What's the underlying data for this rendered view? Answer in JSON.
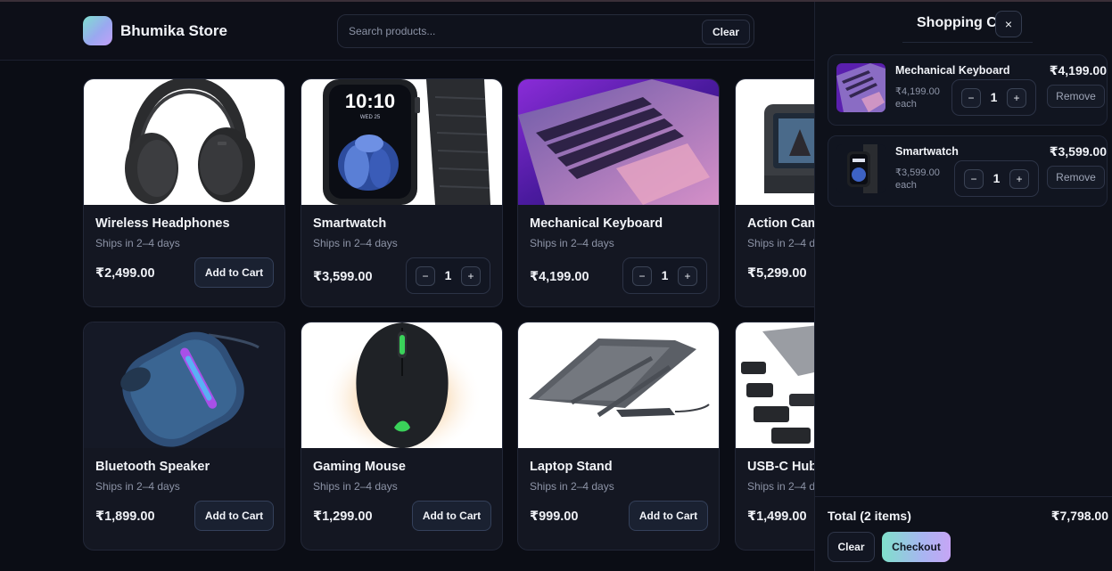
{
  "header": {
    "brand": "Bhumika Store",
    "search_placeholder": "Search products...",
    "search_value": "",
    "clear_label": "Clear"
  },
  "products": [
    {
      "name": "Wireless Headphones",
      "ship": "Ships in 2–4 days",
      "price": "₹2,499.00",
      "action": "Add to Cart"
    },
    {
      "name": "Smartwatch",
      "ship": "Ships in 2–4 days",
      "price": "₹3,599.00",
      "qty": "1",
      "minus": "−",
      "plus": "+"
    },
    {
      "name": "Mechanical Keyboard",
      "ship": "Ships in 2–4 days",
      "price": "₹4,199.00",
      "qty": "1",
      "minus": "−",
      "plus": "+"
    },
    {
      "name": "Action Cam",
      "ship": "Ships in 2–4 d",
      "price": "₹5,299.00"
    },
    {
      "name": "Bluetooth Speaker",
      "ship": "Ships in 2–4 days",
      "price": "₹1,899.00",
      "action": "Add to Cart"
    },
    {
      "name": "Gaming Mouse",
      "ship": "Ships in 2–4 days",
      "price": "₹1,299.00",
      "action": "Add to Cart"
    },
    {
      "name": "Laptop Stand",
      "ship": "Ships in 2–4 days",
      "price": "₹999.00",
      "action": "Add to Cart"
    },
    {
      "name": "USB-C Hub",
      "ship": "Ships in 2–4 d",
      "price": "₹1,499.00"
    }
  ],
  "watch_face": {
    "time": "10:10",
    "date": "WED 25"
  },
  "cart": {
    "title": "Shopping C",
    "close_glyph": "×",
    "items": [
      {
        "name": "Mechanical Keyboard",
        "unit_price": "₹4,199.00",
        "each": "each",
        "qty": "1",
        "total": "₹4,199.00",
        "remove": "Remove",
        "minus": "−",
        "plus": "+"
      },
      {
        "name": "Smartwatch",
        "unit_price": "₹3,599.00",
        "each": "each",
        "qty": "1",
        "total": "₹3,599.00",
        "remove": "Remove",
        "minus": "−",
        "plus": "+"
      }
    ],
    "total_label": "Total (2 items)",
    "total_value": "₹7,798.00",
    "clear_label": "Clear",
    "checkout_label": "Checkout"
  },
  "colors": {
    "background": "#0b0d15",
    "card": "#141722",
    "accent_start": "#7fe0cb",
    "accent_end": "#c6a5f5"
  }
}
